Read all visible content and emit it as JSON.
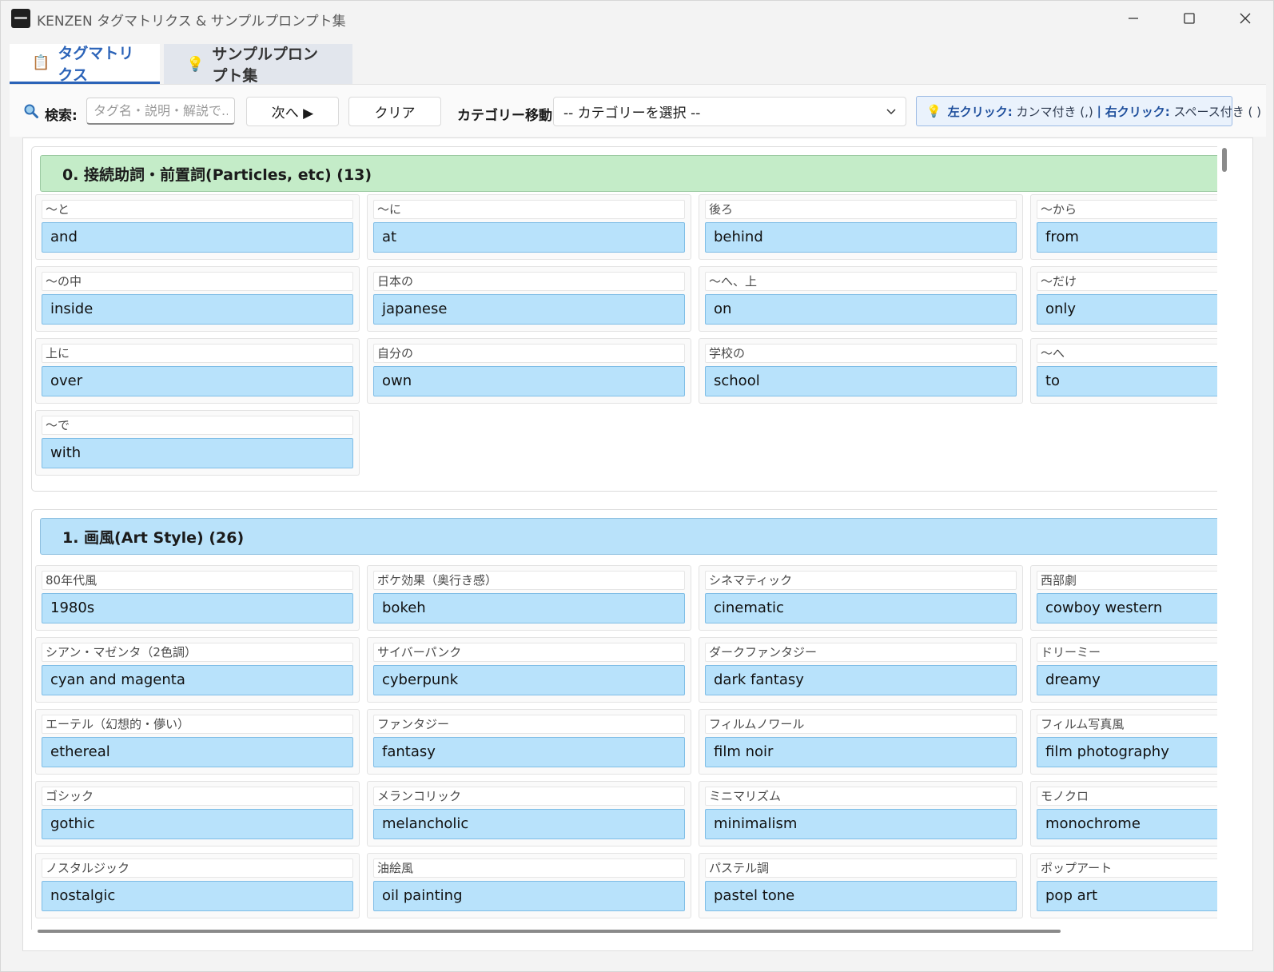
{
  "window": {
    "title": "KENZEN タグマトリクス & サンプルプロンプト集"
  },
  "tabs": [
    {
      "label": "タグマトリクス",
      "icon": "clipboard-icon",
      "active": true
    },
    {
      "label": "サンプルプロンプト集",
      "icon": "lightbulb-icon",
      "active": false
    }
  ],
  "toolbar": {
    "search_label": "検索:",
    "search_placeholder": "タグ名・説明・解説で...",
    "next_label": "次へ ▶",
    "clear_label": "クリア",
    "category_label": "カテゴリー移動:",
    "category_value": "-- カテゴリーを選択 --",
    "hint_left_label": "左クリック:",
    "hint_left_text": "カンマ付き (,)",
    "hint_sep": "|",
    "hint_right_label": "右クリック:",
    "hint_right_text": "スペース付き ( )"
  },
  "sections": [
    {
      "title": "0. 接続助詞・前置詞(Particles, etc) (13)",
      "tags": [
        {
          "jp": "〜と",
          "en": "and"
        },
        {
          "jp": "〜に",
          "en": "at"
        },
        {
          "jp": "後ろ",
          "en": "behind"
        },
        {
          "jp": "〜から",
          "en": "from"
        },
        {
          "jp": "〜の中",
          "en": "inside"
        },
        {
          "jp": "日本の",
          "en": "japanese"
        },
        {
          "jp": "〜へ、上",
          "en": "on"
        },
        {
          "jp": "〜だけ",
          "en": "only"
        },
        {
          "jp": "上に",
          "en": "over"
        },
        {
          "jp": "自分の",
          "en": "own"
        },
        {
          "jp": "学校の",
          "en": "school"
        },
        {
          "jp": "〜へ",
          "en": "to"
        },
        {
          "jp": "〜で",
          "en": "with"
        }
      ]
    },
    {
      "title": "1. 画風(Art Style) (26)",
      "tags": [
        {
          "jp": "80年代風",
          "en": "1980s"
        },
        {
          "jp": "ボケ効果（奥行き感）",
          "en": "bokeh"
        },
        {
          "jp": "シネマティック",
          "en": "cinematic"
        },
        {
          "jp": "西部劇",
          "en": "cowboy western"
        },
        {
          "jp": "シアン・マゼンタ（2色調）",
          "en": "cyan and magenta"
        },
        {
          "jp": "サイバーパンク",
          "en": "cyberpunk"
        },
        {
          "jp": "ダークファンタジー",
          "en": "dark fantasy"
        },
        {
          "jp": "ドリーミー",
          "en": "dreamy"
        },
        {
          "jp": "エーテル（幻想的・儚い）",
          "en": "ethereal"
        },
        {
          "jp": "ファンタジー",
          "en": "fantasy"
        },
        {
          "jp": "フィルムノワール",
          "en": "film noir"
        },
        {
          "jp": "フィルム写真風",
          "en": "film photography"
        },
        {
          "jp": "ゴシック",
          "en": "gothic"
        },
        {
          "jp": "メランコリック",
          "en": "melancholic"
        },
        {
          "jp": "ミニマリズム",
          "en": "minimalism"
        },
        {
          "jp": "モノクロ",
          "en": "monochrome"
        },
        {
          "jp": "ノスタルジック",
          "en": "nostalgic"
        },
        {
          "jp": "油絵風",
          "en": "oil painting"
        },
        {
          "jp": "パステル調",
          "en": "pastel tone"
        },
        {
          "jp": "ポップアート",
          "en": "pop art"
        }
      ]
    }
  ],
  "colors": {
    "accent": "#2b63b8",
    "section0_header": "#c4ecc8",
    "section1_header": "#b9e2fa",
    "tag_button": "#b8e2fb"
  }
}
